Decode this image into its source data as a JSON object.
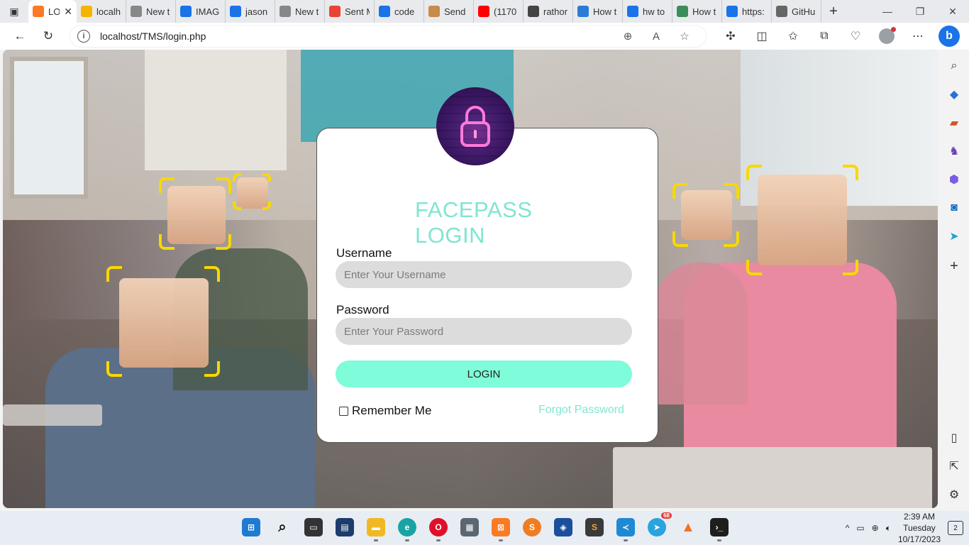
{
  "browser": {
    "tabs": [
      {
        "label": "LO",
        "favicon": "xampp-icon",
        "color": "#fb7a24",
        "active": true
      },
      {
        "label": "localh",
        "favicon": "phpmyadmin-icon",
        "color": "#f4b400"
      },
      {
        "label": "New t",
        "favicon": "newtab-icon",
        "color": "#888888"
      },
      {
        "label": "IMAG",
        "favicon": "search-icon",
        "color": "#1a73e8"
      },
      {
        "label": "jason",
        "favicon": "search-icon",
        "color": "#1a73e8"
      },
      {
        "label": "New t",
        "favicon": "newtab-icon",
        "color": "#888888"
      },
      {
        "label": "Sent M",
        "favicon": "gmail-icon",
        "color": "#ea4335"
      },
      {
        "label": "code",
        "favicon": "search-icon",
        "color": "#1a73e8"
      },
      {
        "label": "Send",
        "favicon": "scroll-icon",
        "color": "#c78b4a"
      },
      {
        "label": "(1170",
        "favicon": "youtube-icon",
        "color": "#ff0000"
      },
      {
        "label": "rathor",
        "favicon": "github-icon",
        "color": "#444444"
      },
      {
        "label": "How t",
        "favicon": "w-icon",
        "color": "#2b7bd6"
      },
      {
        "label": "hw to",
        "favicon": "search-icon",
        "color": "#1a73e8"
      },
      {
        "label": "How t",
        "favicon": "chatgpt-icon",
        "color": "#3c8d5a"
      },
      {
        "label": "https:",
        "favicon": "search-icon",
        "color": "#1a73e8"
      },
      {
        "label": "GitHu",
        "favicon": "page-icon",
        "color": "#666666"
      }
    ],
    "url": "localhost/TMS/login.php"
  },
  "login": {
    "title": "FACEPASS LOGIN",
    "username_label": "Username",
    "username_placeholder": "Enter Your Username",
    "password_label": "Password",
    "password_placeholder": "Enter Your Password",
    "login_button": "LOGIN",
    "remember_label": "Remember Me",
    "forgot_link": "Forgot Password"
  },
  "taskbar": {
    "time": "2:39 AM",
    "day": "Tuesday",
    "date": "10/17/2023",
    "telegram_badge": "68",
    "notification_count": "2"
  },
  "colors": {
    "accent_teal": "#7fe5d1",
    "button_mint": "#7ffcd9",
    "input_gray": "#dcdcdc",
    "face_frame_yellow": "#f7d800",
    "lock_purple": "#3b1763"
  }
}
